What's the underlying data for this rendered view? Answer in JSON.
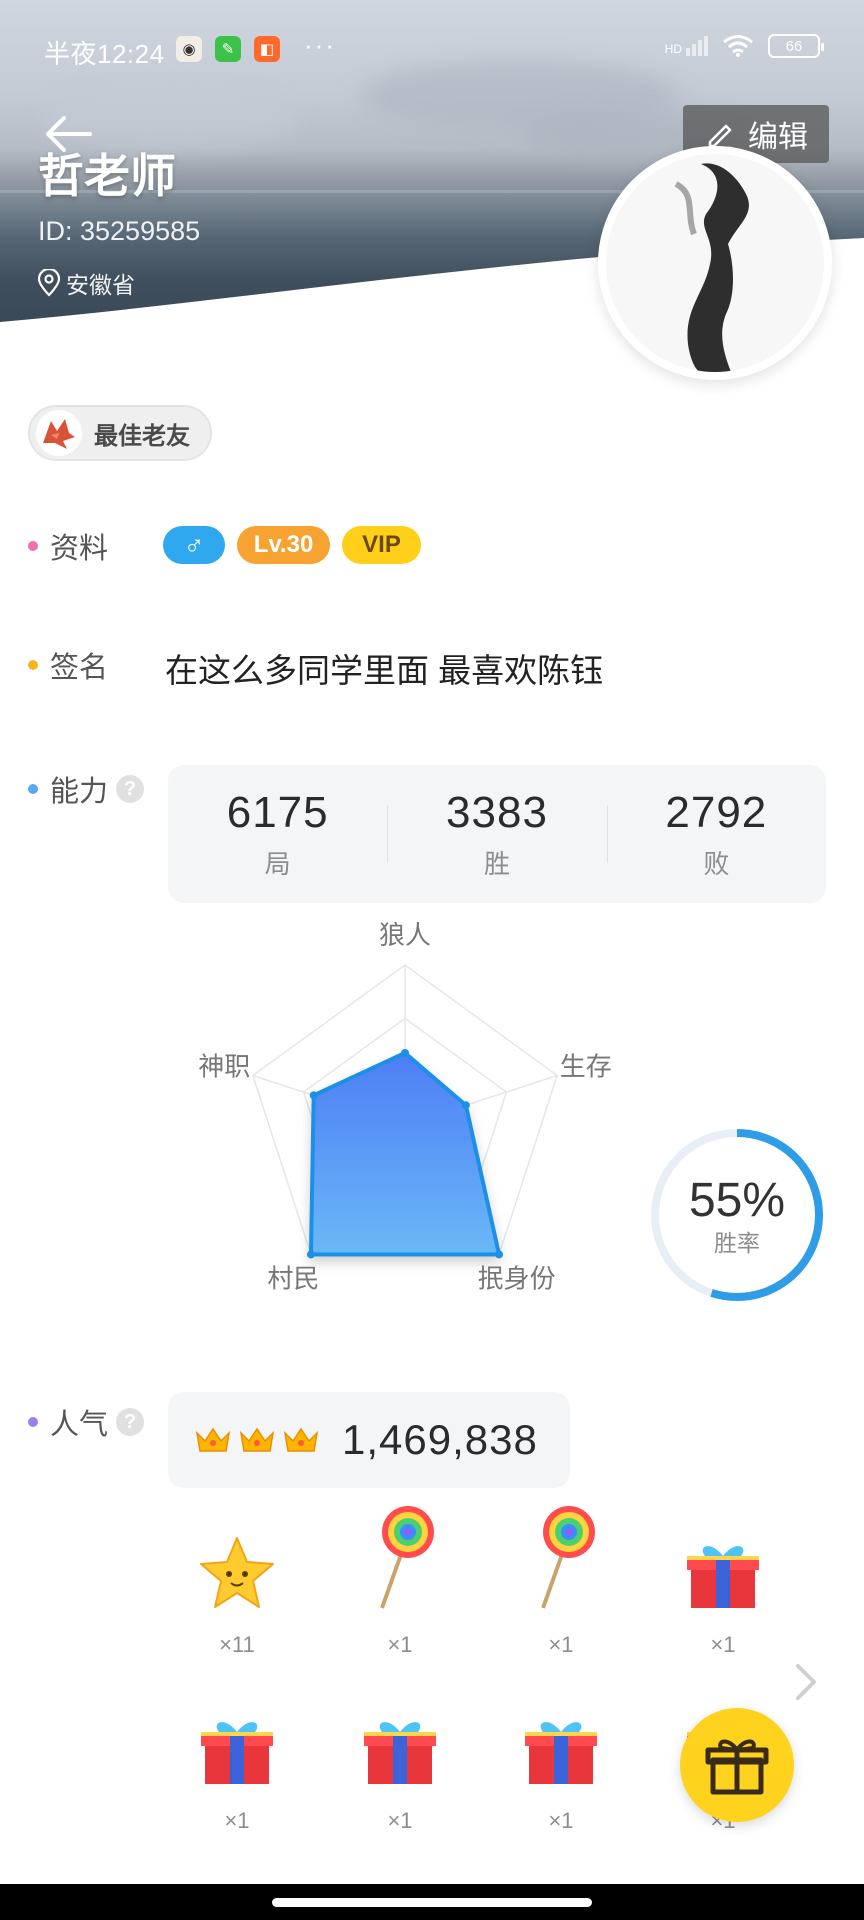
{
  "status_bar": {
    "time": "半夜12:24",
    "dots": "···",
    "hd": "HD",
    "battery": "66"
  },
  "header": {
    "edit_label": "编辑",
    "name": "哲老师",
    "id": "ID: 35259585",
    "location": "安徽省"
  },
  "badge": {
    "label": "最佳老友"
  },
  "profile": {
    "label": "资料",
    "gender_symbol": "♂",
    "level": "Lv.30",
    "vip": "VIP"
  },
  "signature": {
    "label": "签名",
    "text": "在这么多同学里面 最喜欢陈钰"
  },
  "ability": {
    "label": "能力",
    "help": "?",
    "stats": [
      {
        "value": "6175",
        "label": "局"
      },
      {
        "value": "3383",
        "label": "胜"
      },
      {
        "value": "2792",
        "label": "败"
      }
    ],
    "radar": {
      "axes": [
        "狼人",
        "生存",
        "抿身份",
        "村民",
        "神职"
      ],
      "values": [
        0.45,
        0.4,
        1.0,
        1.0,
        0.6
      ]
    },
    "win_rate": {
      "value": "55%",
      "label": "胜率",
      "fraction": 0.55
    }
  },
  "popularity": {
    "label": "人气",
    "help": "?",
    "value": "1,469,838",
    "crowns": 3
  },
  "gifts": [
    {
      "icon": "star-icon",
      "count": "×11"
    },
    {
      "icon": "lollipop-icon",
      "count": "×1"
    },
    {
      "icon": "lollipop-icon",
      "count": "×1"
    },
    {
      "icon": "gift-box-icon",
      "count": "×1"
    },
    {
      "icon": "gift-box-icon",
      "count": "×1"
    },
    {
      "icon": "gift-box-icon",
      "count": "×1"
    },
    {
      "icon": "gift-box-icon",
      "count": "×1"
    },
    {
      "icon": "gift-box-icon",
      "count": "×1"
    }
  ],
  "colors": {
    "accent_blue": "#2f9ce8",
    "level_orange": "#f7a332",
    "vip_yellow": "#ffcf1a",
    "fab_yellow": "#ffd21e"
  }
}
